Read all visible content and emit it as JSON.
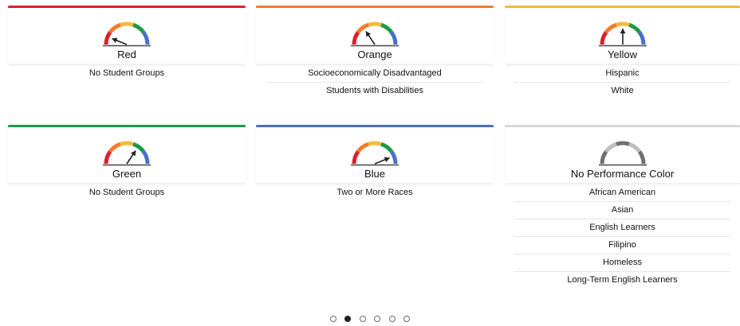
{
  "colors": {
    "red": "#d9222a",
    "orange": "#f07b2d",
    "yellow": "#f6b93b",
    "green": "#1c9a4a",
    "blue": "#4a6fc9",
    "gray": "#cfcfcf"
  },
  "cards": [
    {
      "title": "Red",
      "accent": "#d9222a",
      "needle": "red",
      "groups": [
        "No Student Groups"
      ]
    },
    {
      "title": "Orange",
      "accent": "#f07b2d",
      "needle": "orange",
      "groups": [
        "Socioeconomically Disadvantaged",
        "Students with Disabilities"
      ]
    },
    {
      "title": "Yellow",
      "accent": "#f6b93b",
      "needle": "yellow",
      "groups": [
        "Hispanic",
        "White"
      ]
    },
    {
      "title": "Green",
      "accent": "#1c9a4a",
      "needle": "green",
      "groups": [
        "No Student Groups"
      ]
    },
    {
      "title": "Blue",
      "accent": "#4a6fc9",
      "needle": "blue",
      "groups": [
        "Two or More Races"
      ]
    },
    {
      "title": "No Performance Color",
      "accent": "#d6d6d6",
      "needle": "none",
      "groups": [
        "African American",
        "Asian",
        "English Learners",
        "Filipino",
        "Homeless",
        "Long-Term English Learners"
      ]
    }
  ],
  "pagination": {
    "total": 6,
    "active": 2
  }
}
